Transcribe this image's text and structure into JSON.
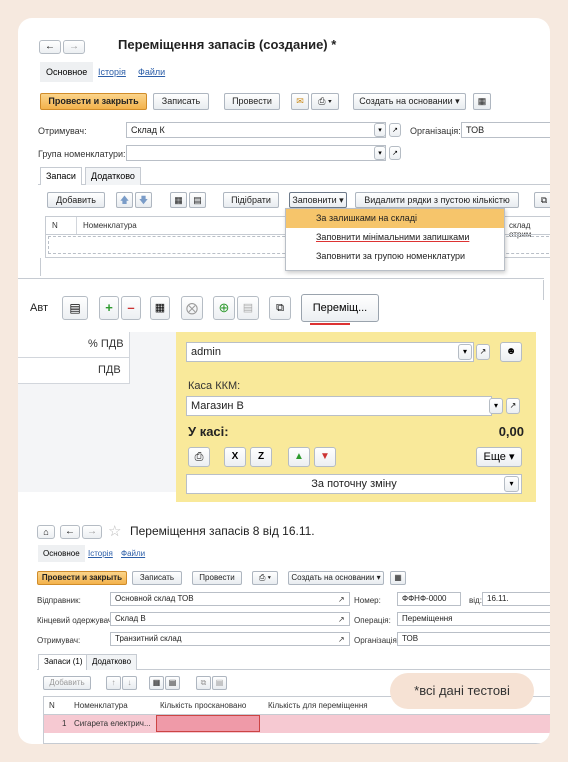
{
  "s1": {
    "title": "Переміщення запасів (создание) *",
    "tabs": [
      "Основное",
      "Історія",
      "Файли"
    ],
    "toolbar": {
      "post_close": "Провести и закрыть",
      "save": "Записать",
      "post": "Провести",
      "create_based": "Создать на основании"
    },
    "recipient_label": "Отримувач:",
    "recipient_value": "Склад К",
    "org_label": "Організація:",
    "org_value": "ТОВ",
    "group_label": "Група номенклатури:",
    "inner_tabs": [
      "Запаси",
      "Додатково"
    ],
    "add": "Добавить",
    "select": "Підібрати",
    "fill": "Заповнити",
    "delete_empty": "Видалити рядки з пустою  кількістю",
    "col_n": "N",
    "col_item": "Номенклатура",
    "col_trunc": "склад отрим",
    "menu": [
      "За залишками на складі",
      "Заповнити мінімальними запишками",
      "Заповнити за групою номенклатури"
    ]
  },
  "s2": {
    "avt": "Авт",
    "transfer": "Переміщ...",
    "vat_pct": "% ПДВ",
    "vat": "ПДВ",
    "user": "admin",
    "cash_label": "Каса ККМ:",
    "cash_value": "Магазин В",
    "in_cash_label": "У касі:",
    "in_cash_value": "0,00",
    "more": "Еще",
    "shift": "За поточну зміну",
    "panel_color": "#f9e99a"
  },
  "s3": {
    "title": "Переміщення запасів 8 від 16.11.",
    "tabs": [
      "Основное",
      "Історія",
      "Файли"
    ],
    "toolbar": {
      "post_close": "Провести и закрыть",
      "save": "Записать",
      "post": "Провести",
      "create_based": "Создать на основании"
    },
    "sender_label": "Відправник:",
    "sender_value": "Основной склад ТОВ",
    "final_label": "Кінцевий одержувач:",
    "final_value": "Склад В",
    "recipient_label": "Отримувач:",
    "recipient_value": "Транзитний склад",
    "number_label": "Номер:",
    "number_value": "ФФНФ-0000",
    "from_label": "від:",
    "from_value": "16.11.",
    "operation_label": "Операція:",
    "operation_value": "Переміщення",
    "org_label": "Організація:",
    "org_value": "ТОВ",
    "inner_tabs": [
      "Запаси (1)",
      "Додатково"
    ],
    "add": "Добавить",
    "col_n": "N",
    "col_item": "Номенклатура",
    "col_scanned": "Кількість проскановано",
    "col_transfer": "Кількість для переміщення",
    "row_n": "1",
    "row_item": "Сигарета електрич..."
  },
  "note": "*всі дані тестові"
}
